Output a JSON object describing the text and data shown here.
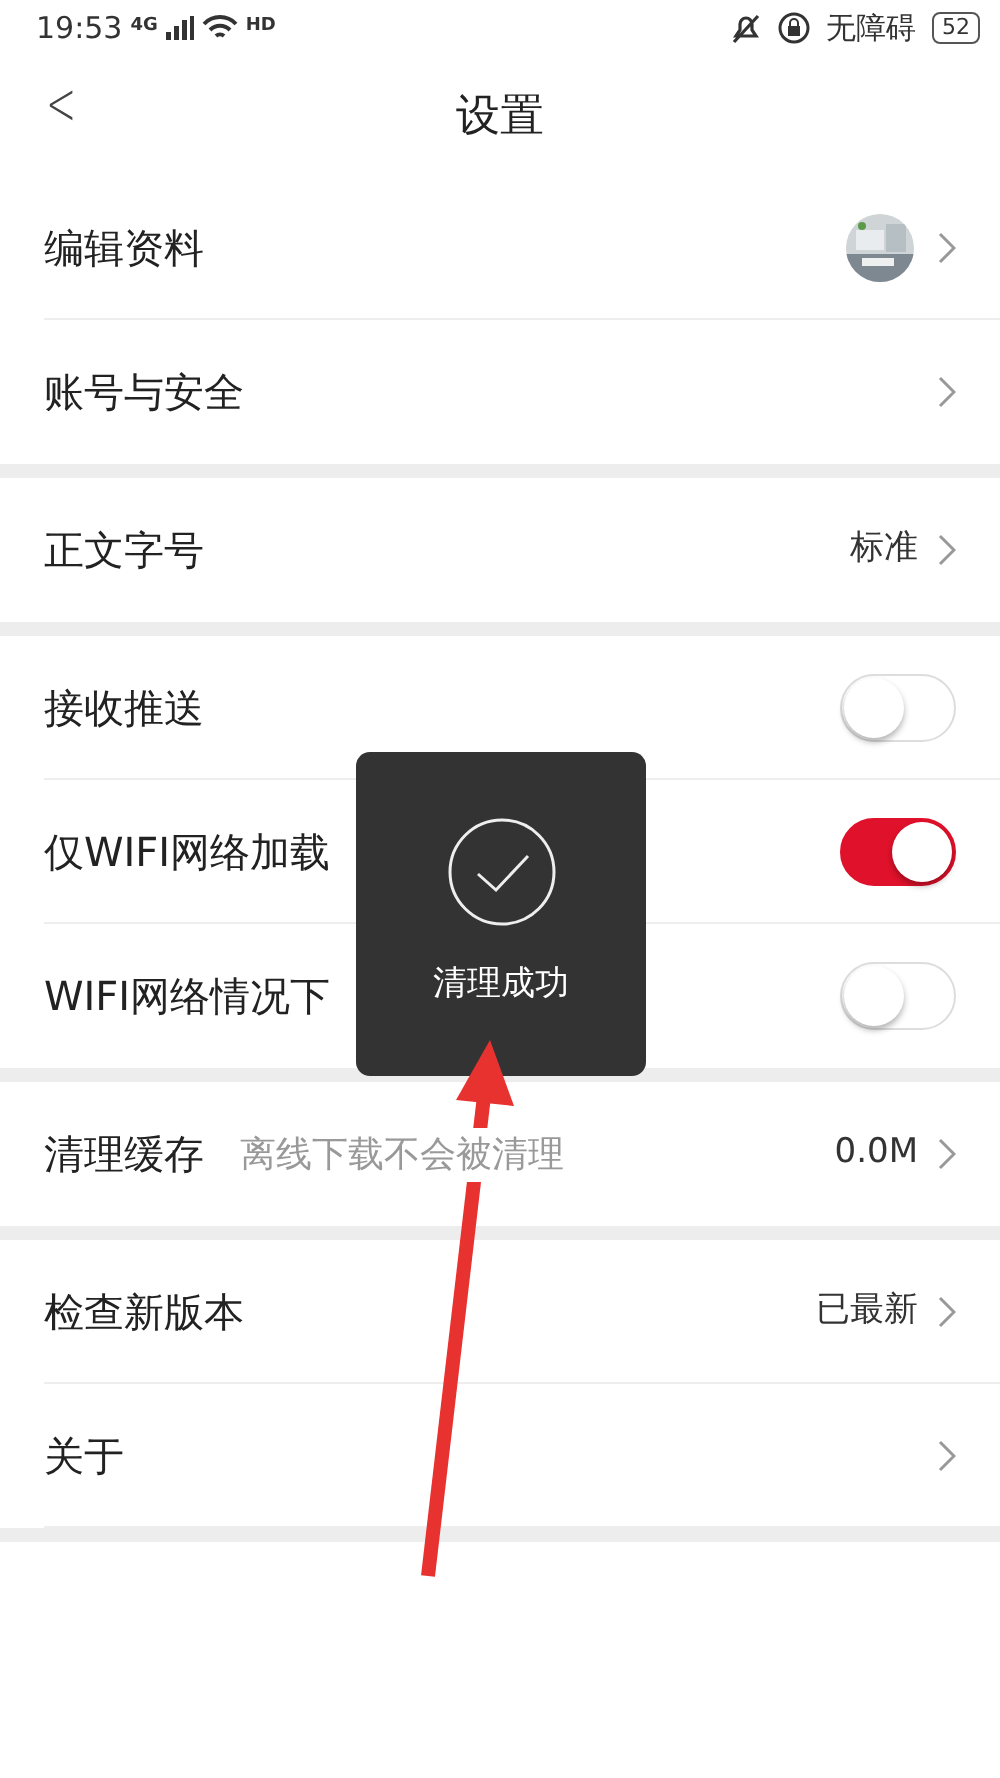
{
  "status_bar": {
    "time": "19:53",
    "network": "4G",
    "wifi_badge": "HD",
    "accessibility": "无障碍",
    "battery": "52"
  },
  "header": {
    "back": "<",
    "title": "设置"
  },
  "groups": [
    {
      "items": [
        {
          "kind": "link",
          "label": "编辑资料",
          "avatar": true
        },
        {
          "kind": "link",
          "label": "账号与安全"
        }
      ]
    },
    {
      "items": [
        {
          "kind": "link",
          "label": "正文字号",
          "value": "标准"
        }
      ]
    },
    {
      "items": [
        {
          "kind": "toggle",
          "label": "接收推送",
          "on": false
        },
        {
          "kind": "toggle",
          "label": "仅WIFI网络加载",
          "on": true
        },
        {
          "kind": "toggle",
          "label": "WIFI网络情况下",
          "on": false
        }
      ]
    },
    {
      "items": [
        {
          "kind": "link",
          "label": "清理缓存",
          "hint": "离线下载不会被清理",
          "value": "0.0M"
        }
      ]
    },
    {
      "items": [
        {
          "kind": "link",
          "label": "检查新版本",
          "value": "已最新"
        },
        {
          "kind": "link",
          "label": "关于"
        }
      ]
    }
  ],
  "toast": {
    "text": "清理成功"
  },
  "annotation": {
    "kind": "arrow"
  }
}
